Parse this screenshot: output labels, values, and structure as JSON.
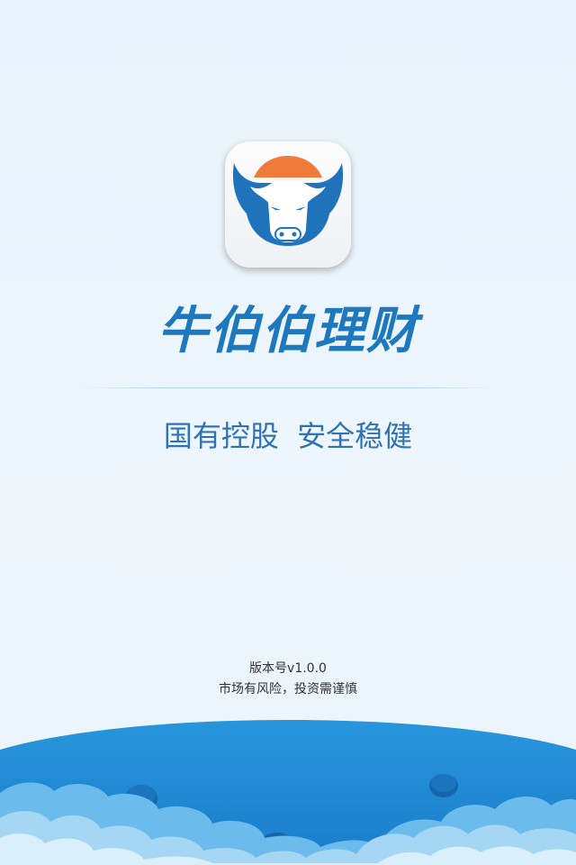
{
  "splash": {
    "brand_name": "牛伯伯理财",
    "slogan": "国有控股  安全稳健",
    "version": "版本号v1.0.0",
    "risk_notice": "市场有风险，投资需谨慎"
  },
  "icons": {
    "app_icon": "bull-head-logo-icon",
    "decoration": "blue-planet-with-clouds"
  },
  "colors": {
    "brand_blue": "#1e78be",
    "accent_orange": "#f07a3a",
    "background": "#e9f3fb",
    "text_dark": "#333333"
  }
}
